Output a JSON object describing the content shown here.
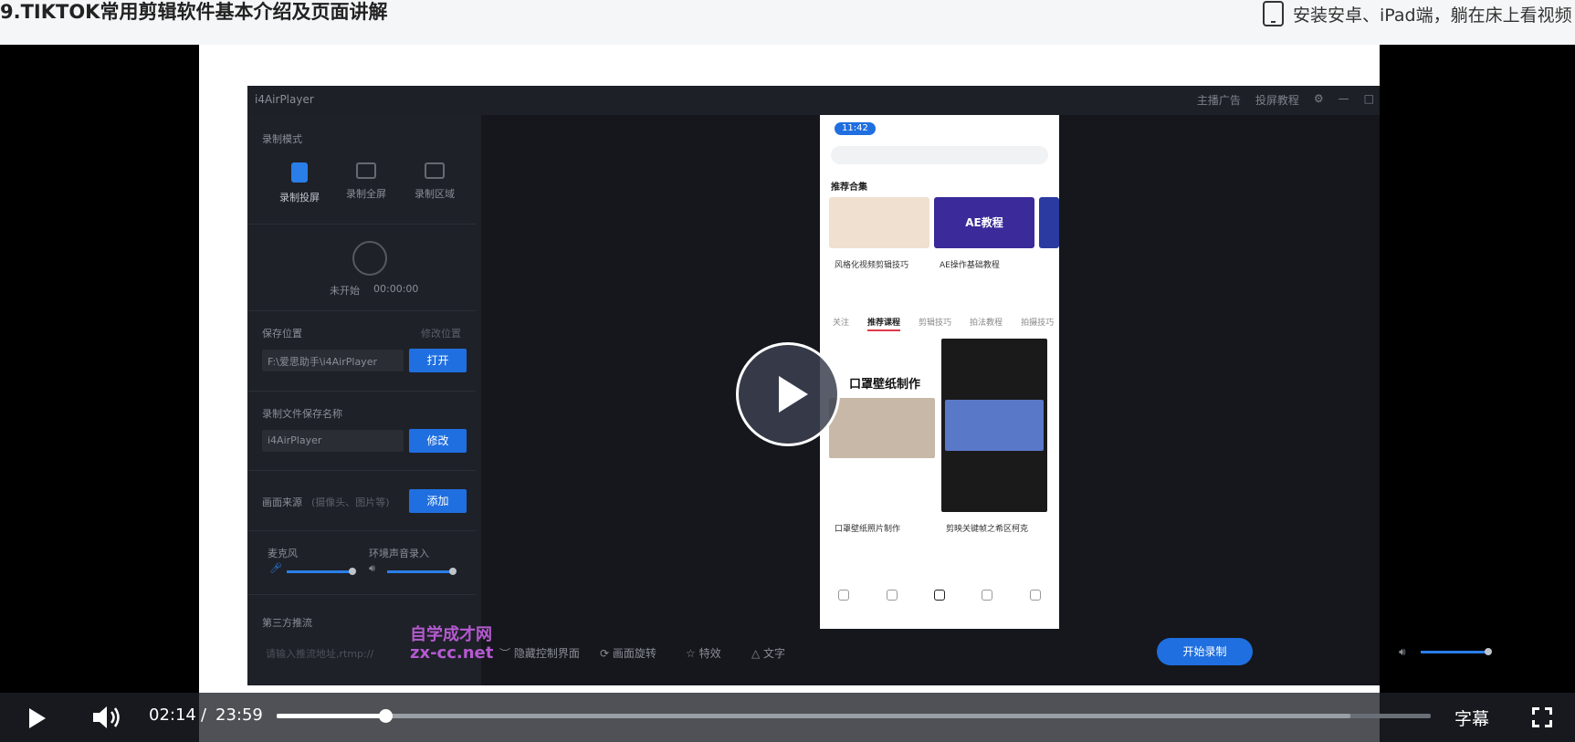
{
  "page": {
    "title": "9.TIKTOK常用剪辑软件基本介绍及页面讲解",
    "install_text": "安装安卓、iPad端，躺在床上看视频"
  },
  "app": {
    "name": "i4AirPlayer",
    "titlebar_items": [
      "主播广告",
      "投屏教程"
    ],
    "record_mode_label": "录制模式",
    "modes": [
      "录制投屏",
      "录制全屏",
      "录制区域"
    ],
    "status": "未开始",
    "timer": "00:00:00",
    "save_location_label": "保存位置",
    "change_location": "修改位置",
    "save_path": "F:\\爱思助手\\i4AirPlayer",
    "open_button": "打开",
    "file_name_label": "录制文件保存名称",
    "file_name": "i4AirPlayer",
    "modify_button": "修改",
    "source_label": "画面来源",
    "source_hint": "(摄像头、图片等)",
    "add_button": "添加",
    "mic_label": "麦克风",
    "ambient_label": "环境声音录入",
    "stream_label": "第三方推流",
    "stream_placeholder": "请输入推流地址,rtmp://",
    "tools": [
      "隐藏控制界面",
      "画面旋转",
      "特效",
      "文字"
    ],
    "start_record": "开始录制"
  },
  "watermark": {
    "line1": "自学成才网",
    "line2": "zx-cc.net"
  },
  "phone": {
    "time": "11:42",
    "section": "推荐合集",
    "cards": [
      "风格化视频剪辑技巧",
      "AE操作基础教程"
    ],
    "badge_ae": "AE教程",
    "tabs": [
      "关注",
      "推荐课程",
      "剪辑技巧",
      "拍法教程",
      "拍摄技巧"
    ],
    "videos": [
      "口罩壁纸照片制作",
      "剪映关键帧之希区柯克"
    ],
    "video_heading": "口罩壁纸制作"
  },
  "player": {
    "current_time": "02:14",
    "separator": "/",
    "duration": "23:59",
    "progress": 0.0939,
    "buffered": 0.93,
    "subtitles_label": "字幕"
  }
}
